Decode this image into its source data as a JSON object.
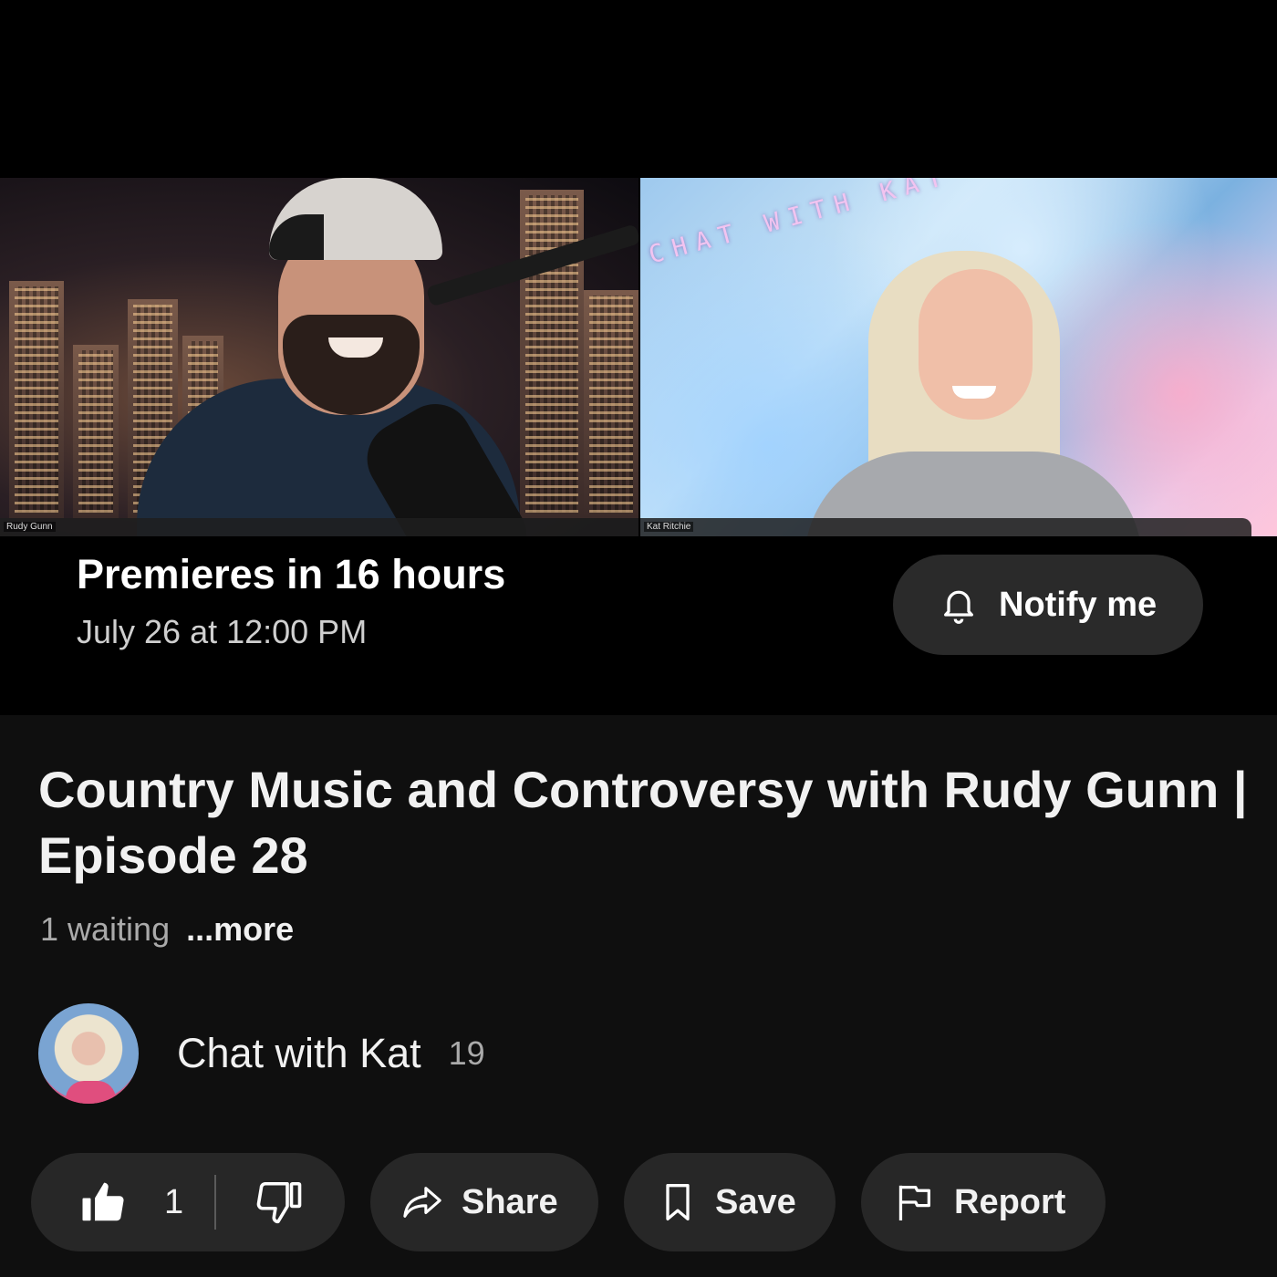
{
  "video": {
    "overlay_text": "CHAT WITH KAT",
    "left_nametag": "Rudy Gunn",
    "right_nametag": "Kat Ritchie"
  },
  "premiere": {
    "status": "Premieres in 16 hours",
    "date": "July 26 at 12:00 PM",
    "notify_label": "Notify me"
  },
  "video_info": {
    "title": "Country Music and Controversy with Rudy Gunn | Episode 28",
    "waiting": "1 waiting",
    "more": "...more"
  },
  "channel": {
    "name": "Chat with Kat",
    "subscribers": "19"
  },
  "actions": {
    "like_count": "1",
    "share_label": "Share",
    "save_label": "Save",
    "report_label": "Report"
  },
  "colors": {
    "background": "#0f0f0f",
    "pill": "#272727",
    "notify_pill": "#2a2a2a",
    "secondary_text": "#aaaaaa"
  }
}
